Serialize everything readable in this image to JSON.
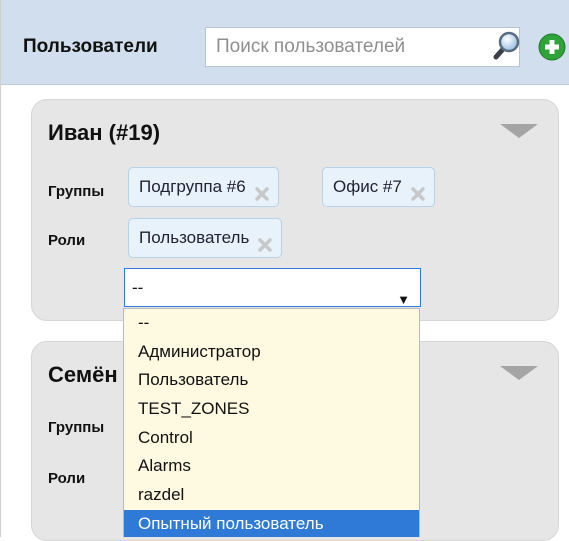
{
  "header": {
    "title": "Пользователи",
    "search_placeholder": "Поиск пользователей",
    "search_icon": "magnifier-icon",
    "add_icon": "green-plus-icon"
  },
  "users": [
    {
      "title": "Иван (#19)",
      "groups_label": "Группы",
      "groups": [
        "Подгруппа #6",
        "Офис #7"
      ],
      "roles_label": "Роли",
      "roles": [
        "Пользователь"
      ],
      "role_select_value": "--"
    },
    {
      "title": "Семён",
      "groups_label": "Группы",
      "roles_label": "Роли"
    }
  ],
  "dropdown": {
    "options": [
      "--",
      "Администратор",
      "Пользователь",
      "TEST_ZONES",
      "Control",
      "Alarms",
      "razdel",
      "Опытный пользователь"
    ],
    "highlighted": "Опытный пользователь"
  },
  "colors": {
    "header_bg": "#d0deed",
    "card_bg": "#e6e6e6",
    "tag_bg": "#e8f2fb",
    "dropdown_bg": "#fefae1",
    "highlight": "#2f7ad6"
  }
}
